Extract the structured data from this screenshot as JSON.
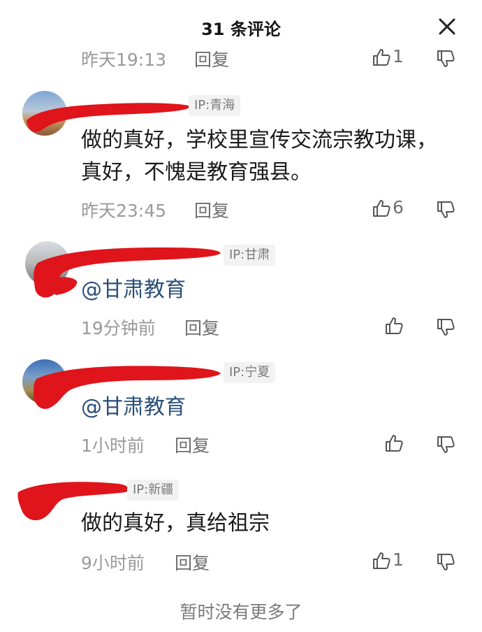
{
  "header": {
    "title": "31 条评论"
  },
  "top_meta": {
    "time": "昨天19:13",
    "reply": "回复",
    "likes": "1"
  },
  "comments": [
    {
      "ip": "IP:青海",
      "text": "做的真好，学校里宣传交流宗教功课，真好，不愧是教育强县。",
      "time": "昨天23:45",
      "reply": "回复",
      "likes": "6"
    },
    {
      "ip": "IP:甘肃",
      "text": "@甘肃教育",
      "time": "19分钟前",
      "reply": "回复",
      "likes": ""
    },
    {
      "ip": "IP:宁夏",
      "text": "@甘肃教育",
      "time": "1小时前",
      "reply": "回复",
      "likes": ""
    },
    {
      "ip": "IP:新疆",
      "text": "做的真好，真给祖宗",
      "time": "9小时前",
      "reply": "回复",
      "likes": "1"
    }
  ],
  "footer": {
    "text": "暂时没有更多了"
  },
  "colors": {
    "redaction": "#e0141b",
    "mention": "#2b4f78",
    "muted": "#9a9a9a"
  }
}
